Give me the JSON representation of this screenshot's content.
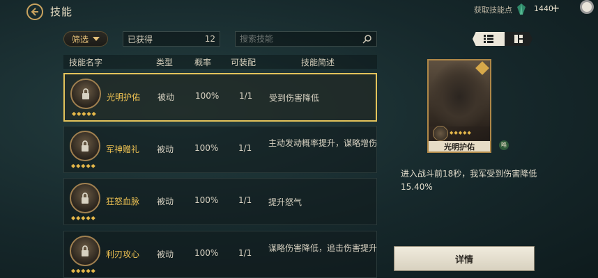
{
  "header": {
    "title": "技能",
    "points_label": "获取技能点",
    "points_value": "1440",
    "plus": "+"
  },
  "filter": {
    "label": "筛选",
    "owned_label": "已获得",
    "owned_count": "12"
  },
  "search": {
    "placeholder": "搜索技能"
  },
  "table": {
    "headers": [
      "技能名字",
      "类型",
      "概率",
      "可装配",
      "技能简述"
    ],
    "rows": [
      {
        "name": "光明护佑",
        "type": "被动",
        "rate": "100%",
        "equip": "1/1",
        "desc": "受到伤害降低"
      },
      {
        "name": "军神赠礼",
        "type": "被动",
        "rate": "100%",
        "equip": "1/1",
        "desc": "主动发动概率提升，谋略增伤"
      },
      {
        "name": "狂怒血脉",
        "type": "被动",
        "rate": "100%",
        "equip": "1/1",
        "desc": "提升怒气"
      },
      {
        "name": "利刃攻心",
        "type": "被动",
        "rate": "100%",
        "equip": "1/1",
        "desc": "谋略伤害降低，追击伤害提升"
      }
    ],
    "stars": "◆◆◆◆◆"
  },
  "detail": {
    "card_name": "光明护佑",
    "card_tag": "略",
    "description": "进入战斗前18秒，我军受到伤害降低15.40%",
    "button_label": "详情"
  },
  "colors": {
    "accent_gold": "#e3c35b",
    "name_gold": "#f1c453"
  }
}
